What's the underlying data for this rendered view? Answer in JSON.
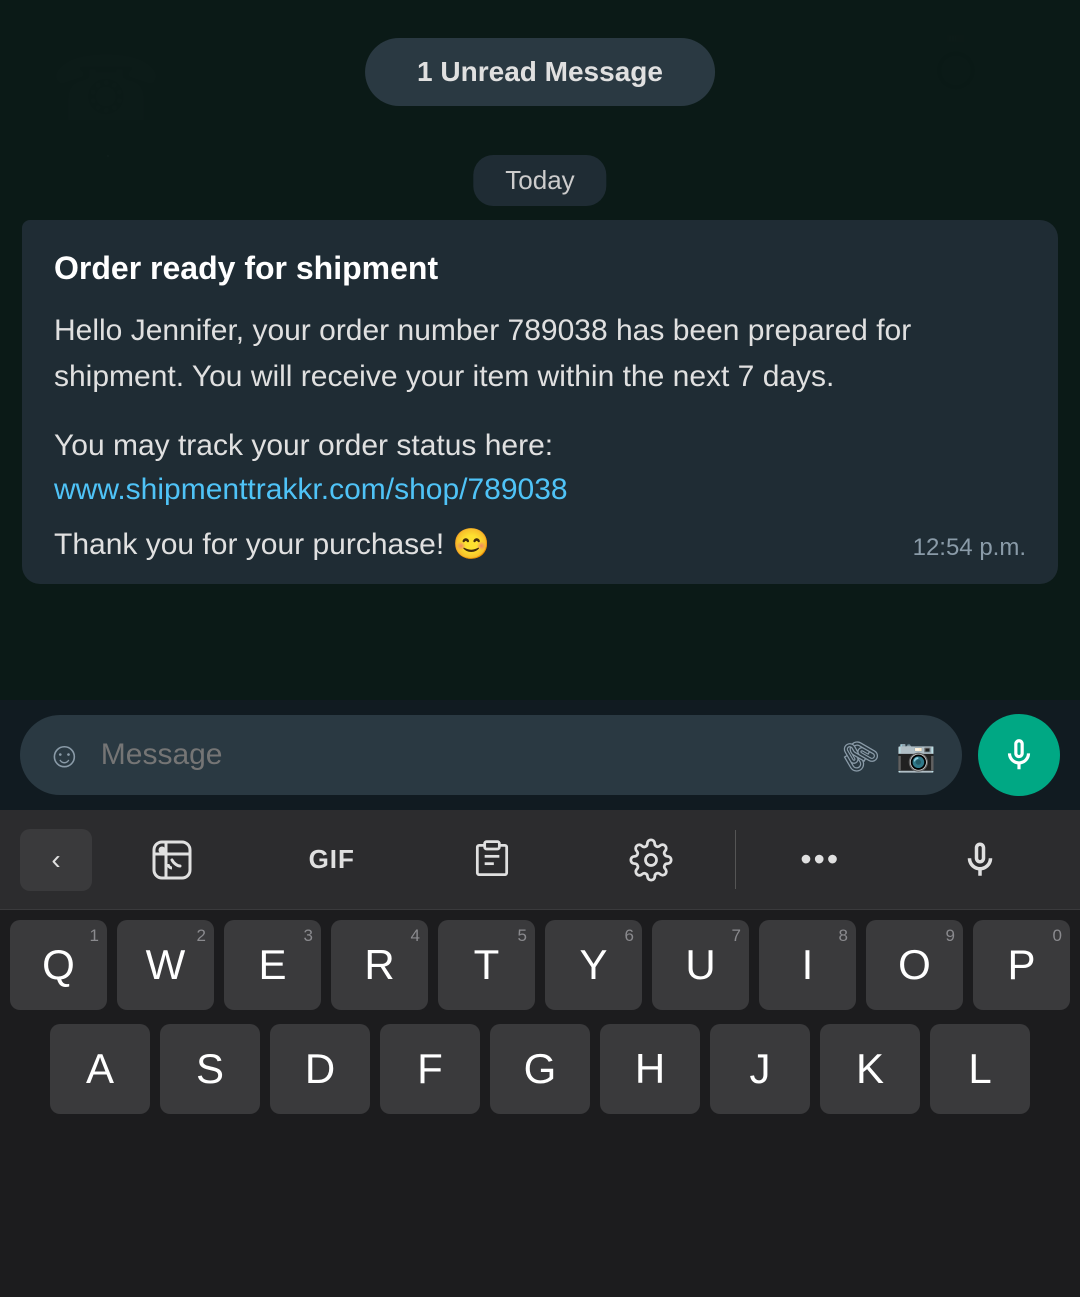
{
  "unread_badge": "1 Unread Message",
  "date_label": "Today",
  "message": {
    "title": "Order ready for shipment",
    "body": "Hello Jennifer, your order number 789038 has been prepared for shipment. You will receive your item within the next 7 days.",
    "track_label": "You may track your order status here:",
    "track_link": "www.shipmenttrakkr.com/shop/789038",
    "thanks": "Thank you for your purchase! 😊",
    "time": "12:54 p.m."
  },
  "input": {
    "placeholder": "Message"
  },
  "keyboard": {
    "toolbar": {
      "back": "‹",
      "sticker": "sticker-icon",
      "gif": "GIF",
      "clipboard": "clipboard-icon",
      "settings": "settings-icon",
      "more": "•••",
      "mic": "mic-icon"
    },
    "row1": [
      {
        "letter": "Q",
        "num": "1"
      },
      {
        "letter": "W",
        "num": "2"
      },
      {
        "letter": "E",
        "num": "3"
      },
      {
        "letter": "R",
        "num": "4"
      },
      {
        "letter": "T",
        "num": "5"
      },
      {
        "letter": "Y",
        "num": "6"
      },
      {
        "letter": "U",
        "num": "7"
      },
      {
        "letter": "I",
        "num": "8"
      },
      {
        "letter": "O",
        "num": "9"
      },
      {
        "letter": "P",
        "num": "0"
      }
    ],
    "row2": [
      {
        "letter": "A"
      },
      {
        "letter": "S"
      },
      {
        "letter": "D"
      },
      {
        "letter": "F"
      },
      {
        "letter": "G"
      },
      {
        "letter": "H"
      },
      {
        "letter": "J"
      },
      {
        "letter": "K"
      },
      {
        "letter": "L"
      }
    ]
  }
}
